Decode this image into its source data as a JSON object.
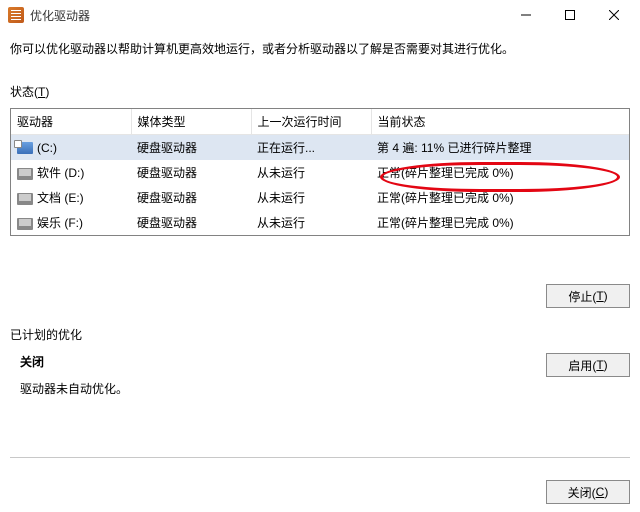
{
  "window": {
    "title": "优化驱动器"
  },
  "description": "你可以优化驱动器以帮助计算机更高效地运行，或者分析驱动器以了解是否需要对其进行优化。",
  "status_label": {
    "text": "状态(",
    "key": "T",
    "suffix": ")"
  },
  "columns": {
    "drive": "驱动器",
    "media": "媒体类型",
    "last": "上一次运行时间",
    "current": "当前状态"
  },
  "rows": [
    {
      "icon": "c",
      "name": "(C:)",
      "media": "硬盘驱动器",
      "last": "正在运行...",
      "status": "第 4 遍: 11% 已进行碎片整理"
    },
    {
      "icon": "hdd",
      "name": "软件 (D:)",
      "media": "硬盘驱动器",
      "last": "从未运行",
      "status": "正常(碎片整理已完成 0%)"
    },
    {
      "icon": "hdd",
      "name": "文档 (E:)",
      "media": "硬盘驱动器",
      "last": "从未运行",
      "status": "正常(碎片整理已完成 0%)"
    },
    {
      "icon": "hdd",
      "name": "娱乐 (F:)",
      "media": "硬盘驱动器",
      "last": "从未运行",
      "status": "正常(碎片整理已完成 0%)"
    }
  ],
  "buttons": {
    "stop": {
      "text": "停止(",
      "key": "T",
      "suffix": ")"
    },
    "enable": {
      "text": "启用(",
      "key": "T",
      "suffix": ")"
    },
    "close": {
      "text": "关闭(",
      "key": "C",
      "suffix": ")"
    }
  },
  "schedule": {
    "title": "已计划的优化",
    "state": "关闭",
    "note": "驱动器未自动优化。"
  }
}
